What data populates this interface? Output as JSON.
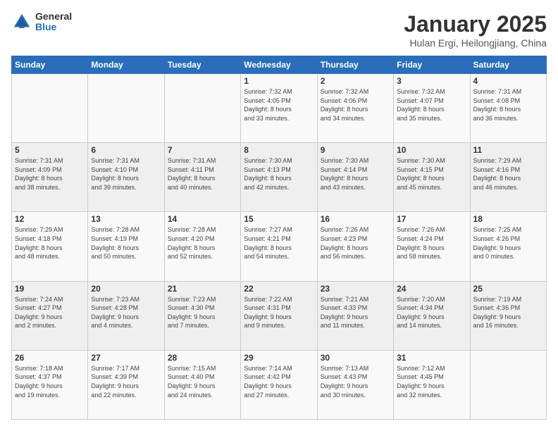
{
  "header": {
    "logo_general": "General",
    "logo_blue": "Blue",
    "month_title": "January 2025",
    "location": "Hulan Ergi, Heilongjiang, China"
  },
  "weekdays": [
    "Sunday",
    "Monday",
    "Tuesday",
    "Wednesday",
    "Thursday",
    "Friday",
    "Saturday"
  ],
  "weeks": [
    [
      {
        "day": "",
        "info": ""
      },
      {
        "day": "",
        "info": ""
      },
      {
        "day": "",
        "info": ""
      },
      {
        "day": "1",
        "info": "Sunrise: 7:32 AM\nSunset: 4:05 PM\nDaylight: 8 hours\nand 33 minutes."
      },
      {
        "day": "2",
        "info": "Sunrise: 7:32 AM\nSunset: 4:06 PM\nDaylight: 8 hours\nand 34 minutes."
      },
      {
        "day": "3",
        "info": "Sunrise: 7:32 AM\nSunset: 4:07 PM\nDaylight: 8 hours\nand 35 minutes."
      },
      {
        "day": "4",
        "info": "Sunrise: 7:31 AM\nSunset: 4:08 PM\nDaylight: 8 hours\nand 36 minutes."
      }
    ],
    [
      {
        "day": "5",
        "info": "Sunrise: 7:31 AM\nSunset: 4:09 PM\nDaylight: 8 hours\nand 38 minutes."
      },
      {
        "day": "6",
        "info": "Sunrise: 7:31 AM\nSunset: 4:10 PM\nDaylight: 8 hours\nand 39 minutes."
      },
      {
        "day": "7",
        "info": "Sunrise: 7:31 AM\nSunset: 4:11 PM\nDaylight: 8 hours\nand 40 minutes."
      },
      {
        "day": "8",
        "info": "Sunrise: 7:30 AM\nSunset: 4:13 PM\nDaylight: 8 hours\nand 42 minutes."
      },
      {
        "day": "9",
        "info": "Sunrise: 7:30 AM\nSunset: 4:14 PM\nDaylight: 8 hours\nand 43 minutes."
      },
      {
        "day": "10",
        "info": "Sunrise: 7:30 AM\nSunset: 4:15 PM\nDaylight: 8 hours\nand 45 minutes."
      },
      {
        "day": "11",
        "info": "Sunrise: 7:29 AM\nSunset: 4:16 PM\nDaylight: 8 hours\nand 46 minutes."
      }
    ],
    [
      {
        "day": "12",
        "info": "Sunrise: 7:29 AM\nSunset: 4:18 PM\nDaylight: 8 hours\nand 48 minutes."
      },
      {
        "day": "13",
        "info": "Sunrise: 7:28 AM\nSunset: 4:19 PM\nDaylight: 8 hours\nand 50 minutes."
      },
      {
        "day": "14",
        "info": "Sunrise: 7:28 AM\nSunset: 4:20 PM\nDaylight: 8 hours\nand 52 minutes."
      },
      {
        "day": "15",
        "info": "Sunrise: 7:27 AM\nSunset: 4:21 PM\nDaylight: 8 hours\nand 54 minutes."
      },
      {
        "day": "16",
        "info": "Sunrise: 7:26 AM\nSunset: 4:23 PM\nDaylight: 8 hours\nand 56 minutes."
      },
      {
        "day": "17",
        "info": "Sunrise: 7:26 AM\nSunset: 4:24 PM\nDaylight: 8 hours\nand 58 minutes."
      },
      {
        "day": "18",
        "info": "Sunrise: 7:25 AM\nSunset: 4:26 PM\nDaylight: 9 hours\nand 0 minutes."
      }
    ],
    [
      {
        "day": "19",
        "info": "Sunrise: 7:24 AM\nSunset: 4:27 PM\nDaylight: 9 hours\nand 2 minutes."
      },
      {
        "day": "20",
        "info": "Sunrise: 7:23 AM\nSunset: 4:28 PM\nDaylight: 9 hours\nand 4 minutes."
      },
      {
        "day": "21",
        "info": "Sunrise: 7:23 AM\nSunset: 4:30 PM\nDaylight: 9 hours\nand 7 minutes."
      },
      {
        "day": "22",
        "info": "Sunrise: 7:22 AM\nSunset: 4:31 PM\nDaylight: 9 hours\nand 9 minutes."
      },
      {
        "day": "23",
        "info": "Sunrise: 7:21 AM\nSunset: 4:33 PM\nDaylight: 9 hours\nand 11 minutes."
      },
      {
        "day": "24",
        "info": "Sunrise: 7:20 AM\nSunset: 4:34 PM\nDaylight: 9 hours\nand 14 minutes."
      },
      {
        "day": "25",
        "info": "Sunrise: 7:19 AM\nSunset: 4:36 PM\nDaylight: 9 hours\nand 16 minutes."
      }
    ],
    [
      {
        "day": "26",
        "info": "Sunrise: 7:18 AM\nSunset: 4:37 PM\nDaylight: 9 hours\nand 19 minutes."
      },
      {
        "day": "27",
        "info": "Sunrise: 7:17 AM\nSunset: 4:39 PM\nDaylight: 9 hours\nand 22 minutes."
      },
      {
        "day": "28",
        "info": "Sunrise: 7:15 AM\nSunset: 4:40 PM\nDaylight: 9 hours\nand 24 minutes."
      },
      {
        "day": "29",
        "info": "Sunrise: 7:14 AM\nSunset: 4:42 PM\nDaylight: 9 hours\nand 27 minutes."
      },
      {
        "day": "30",
        "info": "Sunrise: 7:13 AM\nSunset: 4:43 PM\nDaylight: 9 hours\nand 30 minutes."
      },
      {
        "day": "31",
        "info": "Sunrise: 7:12 AM\nSunset: 4:45 PM\nDaylight: 9 hours\nand 32 minutes."
      },
      {
        "day": "",
        "info": ""
      }
    ]
  ]
}
